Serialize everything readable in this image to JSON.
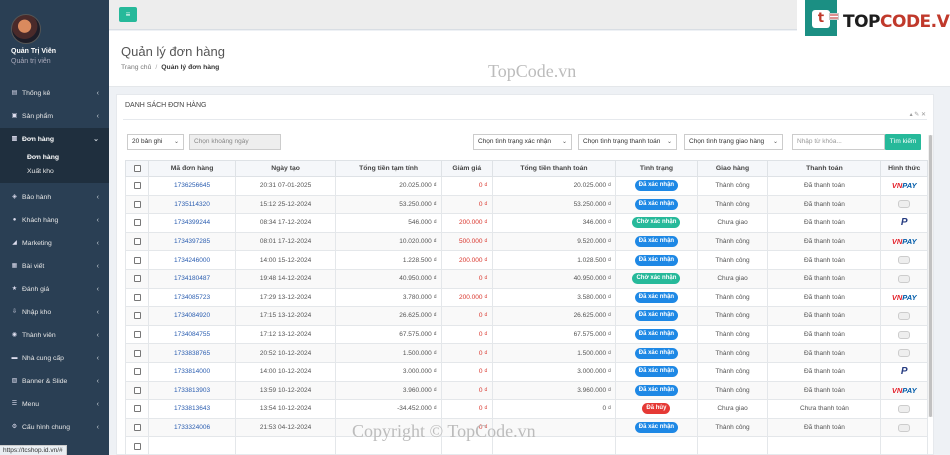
{
  "sidebar": {
    "profile": {
      "name": "Quản Trị Viên",
      "role": "Quản trị viên"
    },
    "items": [
      {
        "label": "Thống kê",
        "icon": "dashboard-icon",
        "chev": "‹"
      },
      {
        "label": "Sản phẩm",
        "icon": "cart-icon",
        "chev": "‹"
      },
      {
        "label": "Đơn hàng",
        "icon": "order-icon",
        "chev": "⌄"
      },
      {
        "label": "Bảo hành",
        "icon": "shield-icon",
        "chev": "‹"
      },
      {
        "label": "Khách hàng",
        "icon": "users-icon",
        "chev": "‹"
      },
      {
        "label": "Marketing",
        "icon": "megaphone-icon",
        "chev": "‹"
      },
      {
        "label": "Bài viết",
        "icon": "newspaper-icon",
        "chev": "‹"
      },
      {
        "label": "Đánh giá",
        "icon": "star-icon",
        "chev": "‹"
      },
      {
        "label": "Nhập kho",
        "icon": "download-icon",
        "chev": "‹"
      },
      {
        "label": "Thành viên",
        "icon": "member-icon",
        "chev": "‹"
      },
      {
        "label": "Nhà cung cấp",
        "icon": "truck-icon",
        "chev": "‹"
      },
      {
        "label": "Banner & Slide",
        "icon": "image-icon",
        "chev": "‹"
      },
      {
        "label": "Menu",
        "icon": "menu-icon",
        "chev": "‹"
      },
      {
        "label": "Cấu hình chung",
        "icon": "gear-icon",
        "chev": "‹"
      }
    ],
    "submenu": [
      "Đơn hàng",
      "Xuất kho"
    ]
  },
  "status_url": "https://tcshop.id.vn/#",
  "toggle_icon": "≡",
  "brand": {
    "prefix": "TOP",
    "suffix": "CODE.VN",
    "mark": "t"
  },
  "watermark": {
    "top": "TopCode.vn",
    "bottom": "Copyright © TopCode.vn"
  },
  "page": {
    "title": "Quản lý đơn hàng",
    "breadcrumb": {
      "home": "Trang chủ",
      "sep": "/",
      "current": "Quản lý đơn hàng"
    }
  },
  "panel": {
    "title": "DANH SÁCH ĐƠN HÀNG",
    "tools": "▴ ✎ ✕",
    "filters": {
      "per_page": "20 bản ghi",
      "date_range_placeholder": "Chọn khoảng ngày",
      "confirm_status": "Chọn tình trạng xác nhận",
      "payment_status": "Chọn tình trạng thanh toán",
      "delivery_status": "Chọn tình trạng giao hàng",
      "keyword_placeholder": "Nhập từ khóa...",
      "search_button": "Tìm kiếm"
    }
  },
  "colors": {
    "sidebar": "#2a3f54",
    "accent": "#26b99a",
    "confirmed": "#1e88e5",
    "pending": "#26b99a",
    "cancelled": "#e53935"
  },
  "table": {
    "headers": [
      "Mã đơn hàng",
      "Ngày tạo",
      "Tổng tiền tạm tính",
      "Giảm giá",
      "Tổng tiền thanh toán",
      "Tình trạng",
      "Giao hàng",
      "Thanh toán",
      "Hình thức"
    ],
    "rows": [
      {
        "code": "1736256645",
        "date": "20:31 07-01-2025",
        "subtotal": "20.025.000 ₫",
        "discount": "0 ₫",
        "total": "20.025.000 ₫",
        "status": "Đã xác nhận",
        "status_color": "#1e88e5",
        "delivery": "Thành công",
        "payment": "Đã thanh toán",
        "method": "vnpay"
      },
      {
        "code": "1735114320",
        "date": "15:12 25-12-2024",
        "subtotal": "53.250.000 ₫",
        "discount": "0 ₫",
        "total": "53.250.000 ₫",
        "status": "Đã xác nhận",
        "status_color": "#1e88e5",
        "delivery": "Thành công",
        "payment": "Đã thanh toán",
        "method": "cash"
      },
      {
        "code": "1734399244",
        "date": "08:34 17-12-2024",
        "subtotal": "546.000 ₫",
        "discount": "200.000 ₫",
        "total": "346.000 ₫",
        "status": "Chờ xác nhận",
        "status_color": "#26b99a",
        "delivery": "Chưa giao",
        "payment": "Đã thanh toán",
        "method": "paypal"
      },
      {
        "code": "1734397285",
        "date": "08:01 17-12-2024",
        "subtotal": "10.020.000 ₫",
        "discount": "500.000 ₫",
        "total": "9.520.000 ₫",
        "status": "Đã xác nhận",
        "status_color": "#1e88e5",
        "delivery": "Thành công",
        "payment": "Đã thanh toán",
        "method": "vnpay"
      },
      {
        "code": "1734246000",
        "date": "14:00 15-12-2024",
        "subtotal": "1.228.500 ₫",
        "discount": "200.000 ₫",
        "total": "1.028.500 ₫",
        "status": "Đã xác nhận",
        "status_color": "#1e88e5",
        "delivery": "Thành công",
        "payment": "Đã thanh toán",
        "method": "cash"
      },
      {
        "code": "1734180487",
        "date": "19:48 14-12-2024",
        "subtotal": "40.950.000 ₫",
        "discount": "0 ₫",
        "total": "40.950.000 ₫",
        "status": "Chờ xác nhận",
        "status_color": "#26b99a",
        "delivery": "Chưa giao",
        "payment": "Đã thanh toán",
        "method": "cash"
      },
      {
        "code": "1734085723",
        "date": "17:29 13-12-2024",
        "subtotal": "3.780.000 ₫",
        "discount": "200.000 ₫",
        "total": "3.580.000 ₫",
        "status": "Đã xác nhận",
        "status_color": "#1e88e5",
        "delivery": "Thành công",
        "payment": "Đã thanh toán",
        "method": "vnpay"
      },
      {
        "code": "1734084920",
        "date": "17:15 13-12-2024",
        "subtotal": "26.625.000 ₫",
        "discount": "0 ₫",
        "total": "26.625.000 ₫",
        "status": "Đã xác nhận",
        "status_color": "#1e88e5",
        "delivery": "Thành công",
        "payment": "Đã thanh toán",
        "method": "cash"
      },
      {
        "code": "1734084755",
        "date": "17:12 13-12-2024",
        "subtotal": "67.575.000 ₫",
        "discount": "0 ₫",
        "total": "67.575.000 ₫",
        "status": "Đã xác nhận",
        "status_color": "#1e88e5",
        "delivery": "Thành công",
        "payment": "Đã thanh toán",
        "method": "cash"
      },
      {
        "code": "1733838765",
        "date": "20:52 10-12-2024",
        "subtotal": "1.500.000 ₫",
        "discount": "0 ₫",
        "total": "1.500.000 ₫",
        "status": "Đã xác nhận",
        "status_color": "#1e88e5",
        "delivery": "Thành công",
        "payment": "Đã thanh toán",
        "method": "cash"
      },
      {
        "code": "1733814000",
        "date": "14:00 10-12-2024",
        "subtotal": "3.000.000 ₫",
        "discount": "0 ₫",
        "total": "3.000.000 ₫",
        "status": "Đã xác nhận",
        "status_color": "#1e88e5",
        "delivery": "Thành công",
        "payment": "Đã thanh toán",
        "method": "paypal"
      },
      {
        "code": "1733813903",
        "date": "13:59 10-12-2024",
        "subtotal": "3.960.000 ₫",
        "discount": "0 ₫",
        "total": "3.960.000 ₫",
        "status": "Đã xác nhận",
        "status_color": "#1e88e5",
        "delivery": "Thành công",
        "payment": "Đã thanh toán",
        "method": "vnpay"
      },
      {
        "code": "1733813643",
        "date": "13:54 10-12-2024",
        "subtotal": "-34.452.000 ₫",
        "discount": "0 ₫",
        "total": "0 ₫",
        "status": "Đã hủy",
        "status_color": "#e53935",
        "delivery": "Chưa giao",
        "payment": "Chưa thanh toán",
        "method": "cash"
      },
      {
        "code": "1733324006",
        "date": "21:53 04-12-2024",
        "subtotal": "",
        "discount": "0 ₫",
        "total": "",
        "status": "Đã xác nhận",
        "status_color": "#1e88e5",
        "delivery": "Thành công",
        "payment": "Đã thanh toán",
        "method": "cash"
      },
      {
        "code": "",
        "date": "",
        "subtotal": "",
        "discount": "",
        "total": "",
        "status": "",
        "status_color": "#1e88e5",
        "delivery": "",
        "payment": "",
        "method": ""
      }
    ]
  }
}
